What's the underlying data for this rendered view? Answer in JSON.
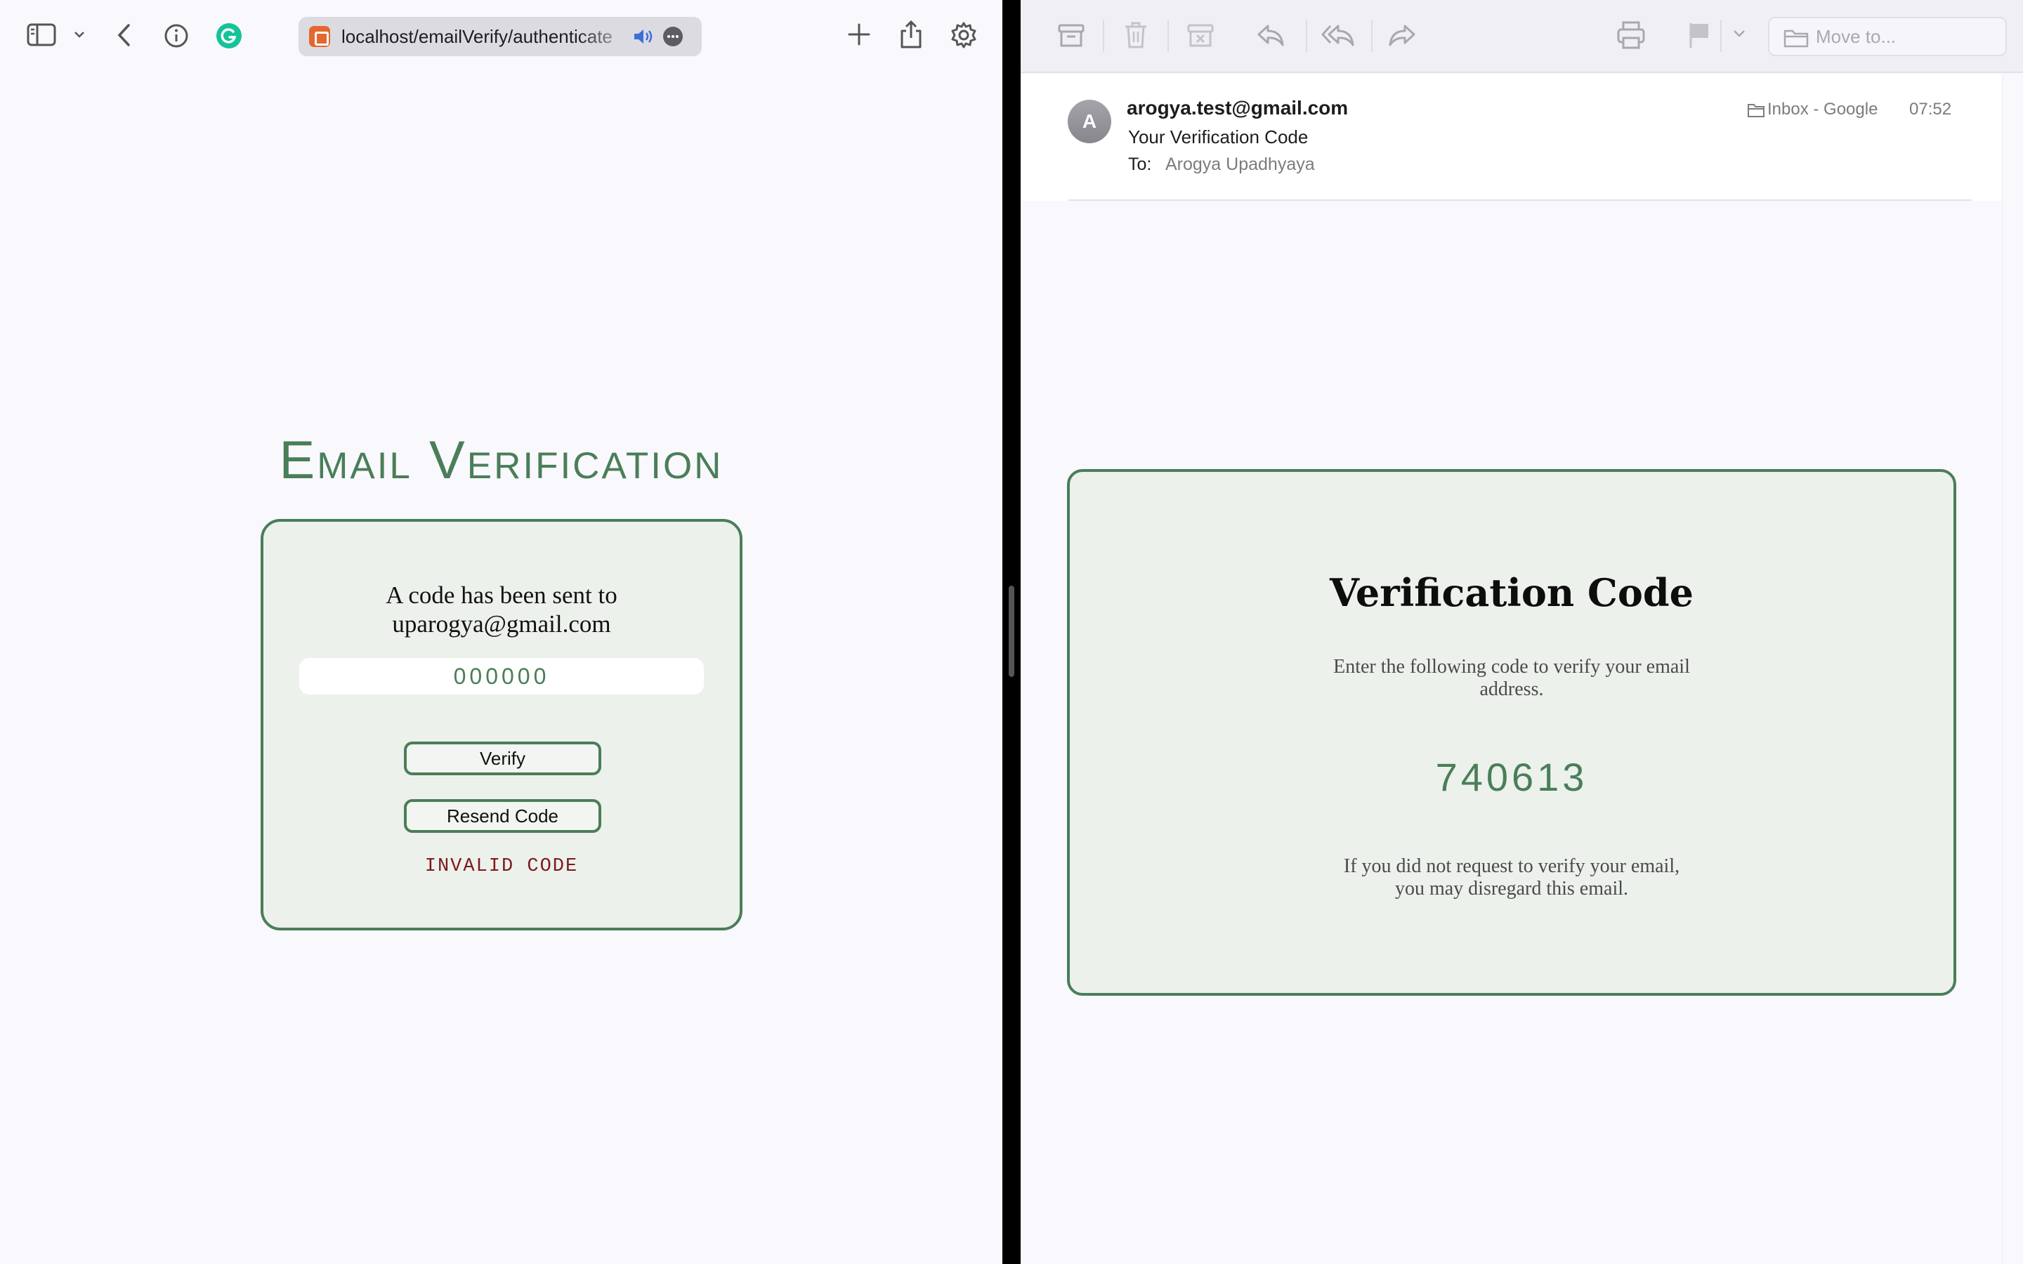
{
  "browser": {
    "url": "localhost/emailVerify/authenticate",
    "icons": [
      "sidebar-icon",
      "chevron-down-icon",
      "back-icon",
      "info-icon",
      "grammarly-icon",
      "favicon",
      "audio-icon",
      "ellipsis-icon",
      "plus-icon",
      "share-icon",
      "gear-icon"
    ]
  },
  "verify_page": {
    "heading": "Email Verification",
    "sent_line_1": "A code has been sent to",
    "sent_line_2": "uparogya@gmail.com",
    "code_placeholder": "000000",
    "verify_label": "Verify",
    "resend_label": "Resend Code",
    "error_message": "INVALID CODE",
    "accent_color": "#4a7e58",
    "error_color": "#7c1a1a"
  },
  "mail_toolbar": {
    "icons": [
      "archive-icon",
      "trash-icon",
      "junk-icon",
      "reply-icon",
      "reply-all-icon",
      "forward-icon",
      "print-icon",
      "flag-icon",
      "chevron-down-icon",
      "folder-icon"
    ],
    "move_to_label": "Move to..."
  },
  "mail": {
    "avatar_letter": "A",
    "sender": "arogya.test@gmail.com",
    "subject": "Your Verification Code",
    "to_label": "To:",
    "to_name": "Arogya Upadhyaya",
    "mailbox": "Inbox - Google",
    "time": "07:52"
  },
  "mail_body": {
    "title": "Verification Code",
    "instructions_line_1": "Enter the following code to verify your email",
    "instructions_line_2": "address.",
    "code": "740613",
    "disclaimer_line_1": "If you did not request to verify your email,",
    "disclaimer_line_2": "you may disregard this email."
  }
}
